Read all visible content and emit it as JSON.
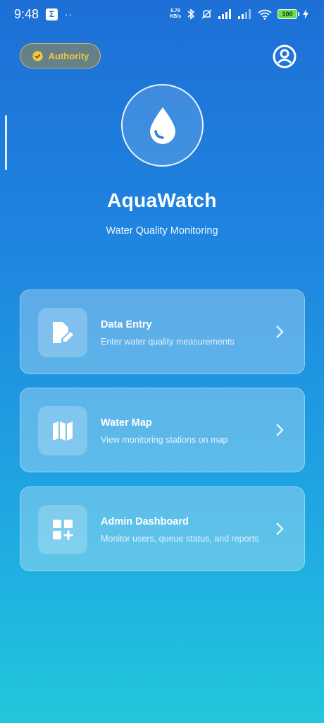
{
  "status_bar": {
    "time": "9:48",
    "app_badge": "Σ",
    "dots": "··",
    "net_speed_value": "6.79",
    "net_speed_unit": "KB/s",
    "battery": "100"
  },
  "header": {
    "authority_label": "Authority",
    "authority_color": "#f2c744",
    "profile_icon": "account-circle-icon"
  },
  "logo": {
    "icon": "water-drop-icon"
  },
  "app": {
    "title": "AquaWatch",
    "subtitle": "Water Quality Monitoring"
  },
  "menu": [
    {
      "title": "Data Entry",
      "description": "Enter water quality measurements",
      "icon": "edit-document-icon"
    },
    {
      "title": "Water Map",
      "description": "View monitoring stations on map",
      "icon": "map-icon"
    },
    {
      "title": "Admin Dashboard",
      "description": "Monitor users, queue status, and reports",
      "icon": "dashboard-add-icon"
    }
  ]
}
